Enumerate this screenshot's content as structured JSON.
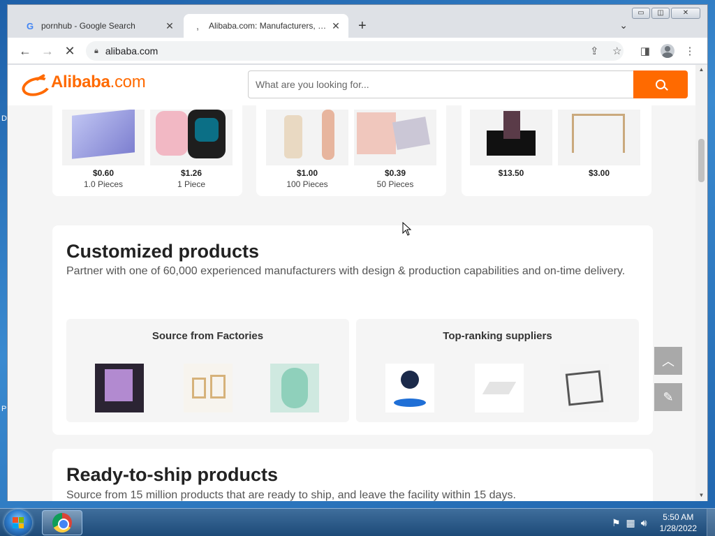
{
  "browser": {
    "tabs": [
      {
        "title": "pornhub - Google Search",
        "favicon": "G",
        "active": false
      },
      {
        "title": "Alibaba.com: Manufacturers, Suppliers, Exporters & Importers",
        "favicon": "‚",
        "active": true
      }
    ],
    "new_tab": "+",
    "tab_menu": "⌄",
    "url": "alibaba.com",
    "window_controls": {
      "minimize": "▭",
      "maximize": "◫",
      "close": "✕"
    }
  },
  "site": {
    "logo_brand": "Alibaba",
    "logo_suffix": ".com",
    "search_placeholder": "What are you looking for..."
  },
  "top_products": [
    {
      "price": "$0.60",
      "moq": "1.0 Pieces",
      "tone": "#d9dcf2"
    },
    {
      "price": "$1.26",
      "moq": "1 Piece",
      "tone": "#f0d6da"
    },
    {
      "price": "$1.00",
      "moq": "100 Pieces",
      "tone": "#f1ece6"
    },
    {
      "price": "$0.39",
      "moq": "50 Pieces",
      "tone": "#eadbd8"
    },
    {
      "price": "$13.50",
      "moq": "",
      "tone": "#e8e8e8"
    },
    {
      "price": "$3.00",
      "moq": "",
      "tone": "#f0ece4"
    }
  ],
  "customized": {
    "title": "Customized products",
    "subtitle": "Partner with one of 60,000 experienced manufacturers with design & production capabilities and on-time delivery.",
    "panels": [
      {
        "title": "Source from Factories",
        "tones": [
          "#2b2433",
          "#efe8dc",
          "#cfe9e0"
        ]
      },
      {
        "title": "Top-ranking suppliers",
        "tones": [
          "#1b2a4a",
          "#ececec",
          "#bdbdbd"
        ]
      }
    ]
  },
  "ready_to_ship": {
    "title": "Ready-to-ship products",
    "subtitle": "Source from 15 million products that are ready to ship, and leave the facility within 15 days."
  },
  "float_buttons": {
    "top": "︿",
    "feedback": "✎"
  },
  "taskbar": {
    "time": "5:50 AM",
    "date": "1/28/2022",
    "tray_icons": [
      "flag-icon",
      "network-icon",
      "volume-icon"
    ]
  },
  "desktop_glyphs": [
    "D",
    "P"
  ]
}
